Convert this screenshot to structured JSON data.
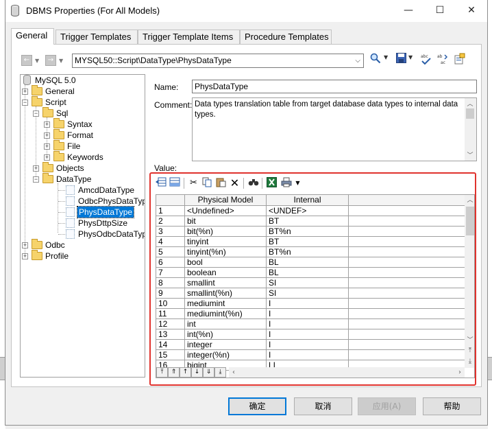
{
  "window": {
    "title": "DBMS Properties (For All Models)",
    "minimize": "—",
    "maximize": "☐",
    "close": "✕"
  },
  "tabs": [
    {
      "label": "General",
      "active": true
    },
    {
      "label": "Trigger Templates",
      "active": false
    },
    {
      "label": "Trigger Template Items",
      "active": false
    },
    {
      "label": "Procedure Templates",
      "active": false
    }
  ],
  "toolbar": {
    "back": "←",
    "forward": "→",
    "path": "MYSQL50::Script\\DataType\\PhysDataType",
    "icons": [
      "search-icon",
      "save-icon",
      "spellcheck-icon",
      "replace-icon",
      "properties-icon"
    ]
  },
  "tree": {
    "root": "MySQL 5.0",
    "general": "General",
    "script": "Script",
    "sql": "Sql",
    "syntax": "Syntax",
    "format": "Format",
    "file": "File",
    "keywords": "Keywords",
    "objects": "Objects",
    "datatype": "DataType",
    "amcd": "AmcdDataType",
    "odbcphys": "OdbcPhysDataType",
    "phys": "PhysDataType",
    "physdttp": "PhysDttpSize",
    "physodbc": "PhysOdbcDataType",
    "odbc": "Odbc",
    "profile": "Profile"
  },
  "form": {
    "name_label": "Name:",
    "name_value": "PhysDataType",
    "comment_label": "Comment:",
    "comment_value": "Data types translation table from target database data types to internal data types.",
    "value_label": "Value:"
  },
  "grid": {
    "columns": [
      "Physical Model",
      "Internal"
    ],
    "rows": [
      [
        "1",
        "<Undefined>",
        "<UNDEF>"
      ],
      [
        "2",
        "bit",
        "BT"
      ],
      [
        "3",
        "bit(%n)",
        "BT%n"
      ],
      [
        "4",
        "tinyint",
        "BT"
      ],
      [
        "5",
        "tinyint(%n)",
        "BT%n"
      ],
      [
        "6",
        "bool",
        "BL"
      ],
      [
        "7",
        "boolean",
        "BL"
      ],
      [
        "8",
        "smallint",
        "SI"
      ],
      [
        "9",
        "smallint(%n)",
        "SI"
      ],
      [
        "10",
        "mediumint",
        "I"
      ],
      [
        "11",
        "mediumint(%n)",
        "I"
      ],
      [
        "12",
        "int",
        "I"
      ],
      [
        "13",
        "int(%n)",
        "I"
      ],
      [
        "14",
        "integer",
        "I"
      ],
      [
        "15",
        "integer(%n)",
        "I"
      ],
      [
        "16",
        "bigint",
        "LI"
      ]
    ]
  },
  "buttons": {
    "ok": "确定",
    "cancel": "取消",
    "apply": "应用(A)",
    "help": "帮助"
  }
}
